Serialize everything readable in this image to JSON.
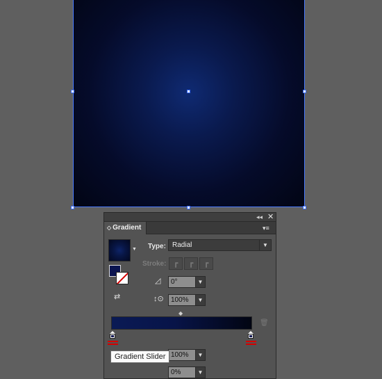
{
  "panel": {
    "tab_label": "Gradient",
    "tab_arrow": "◇",
    "collapse_glyph": "◂◂",
    "close_glyph": "✕",
    "menu_glyph": "▾≡",
    "type": {
      "label": "Type:",
      "value": "Radial",
      "options": [
        "Radial"
      ]
    },
    "stroke": {
      "label": "Stroke:"
    },
    "angle": {
      "value": "0°"
    },
    "aspect_ratio": {
      "value": "100%"
    },
    "opacity": {
      "value": "100%"
    },
    "location": {
      "value": "0%"
    }
  },
  "tooltip": {
    "text": "Gradient Slider"
  },
  "colors": {
    "gradient_center": "#0f2a72",
    "gradient_edge": "#020514",
    "selection_blue": "#4a7bff",
    "stop_marker_red": "#d40000"
  },
  "icons": [
    "collapse-icon",
    "close-icon",
    "panel-menu-icon",
    "dropdown-arrow-icon",
    "angle-icon",
    "aspect-ratio-icon",
    "reverse-gradient-icon",
    "midpoint-diamond-icon",
    "trash-icon",
    "gradient-stop-icon"
  ]
}
